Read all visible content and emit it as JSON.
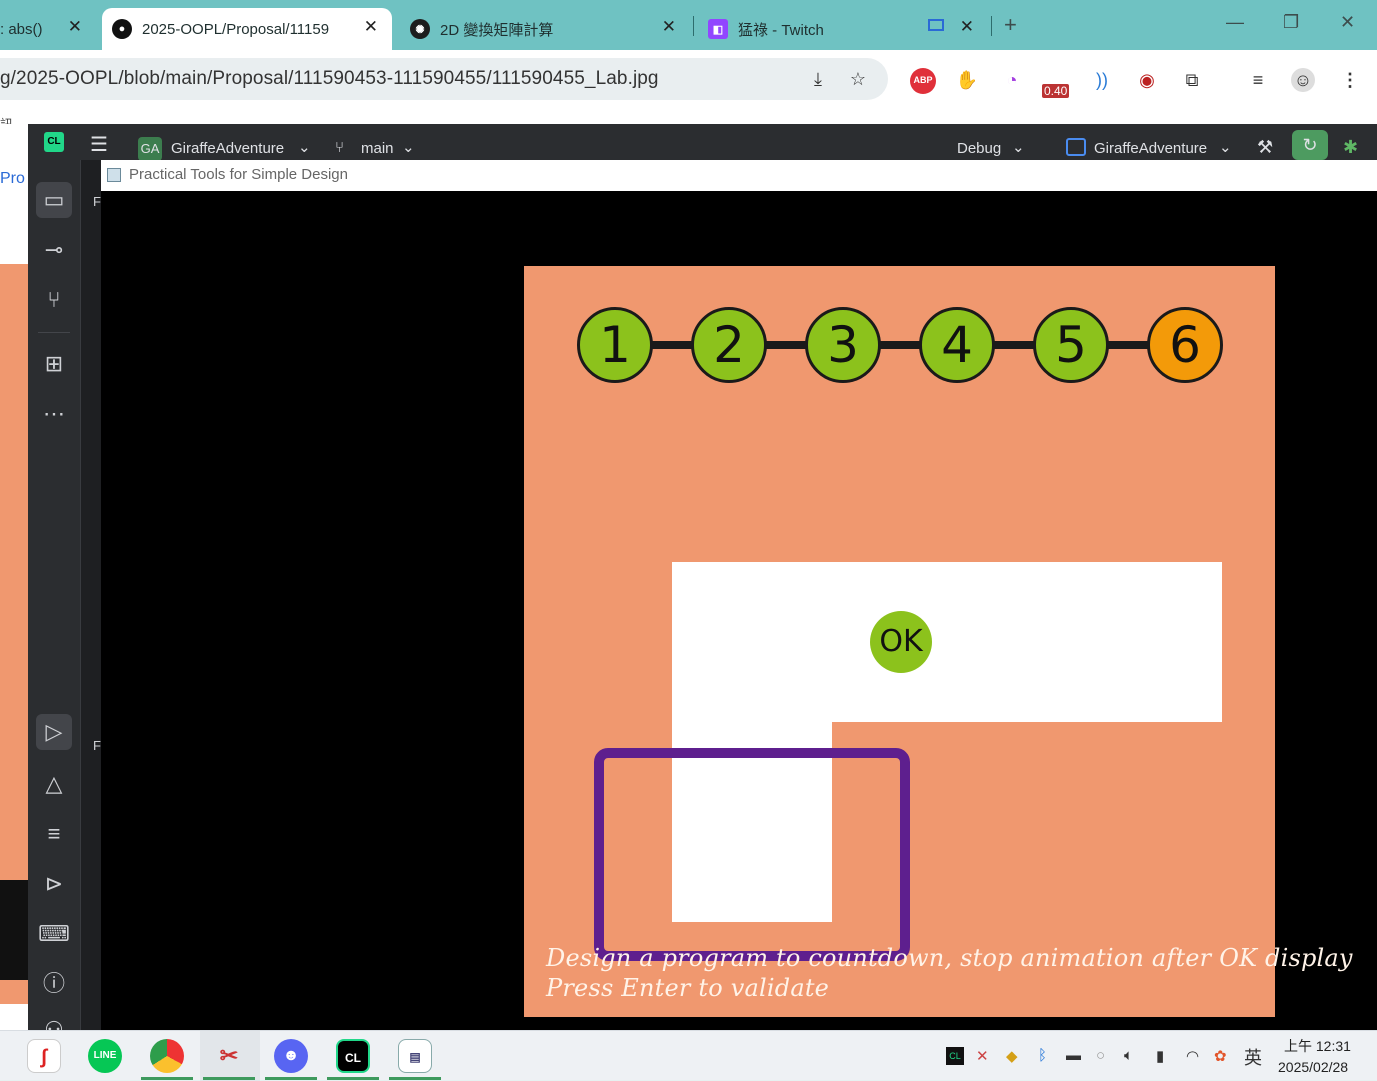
{
  "browser": {
    "tabs": [
      {
        "title": ": abs()",
        "icon": "generic-tab-icon"
      },
      {
        "title": "2025-OOPL/Proposal/11159",
        "icon": "github-icon"
      },
      {
        "title": "2D 變換矩陣計算",
        "icon": "openai-icon"
      },
      {
        "title": "猛祿 - Twitch",
        "icon": "twitch-icon"
      }
    ],
    "url": "g/2025-OOPL/blob/main/Proposal/111590453-111590455/111590455_Lab.jpg",
    "extension_badge": "0.40",
    "bookmark_edge": "訊"
  },
  "ide": {
    "project_badge": "GA",
    "project_name": "GiraffeAdventure",
    "branch": "main",
    "run_config": "Debug",
    "target": "GiraffeAdventure",
    "left_page_fragment": "Pro",
    "panel_letters": [
      "F",
      "F"
    ]
  },
  "game": {
    "window_title": "Practical Tools for Simple Design",
    "steps": [
      "1",
      "2",
      "3",
      "4",
      "5",
      "6"
    ],
    "current_step": 6,
    "ok_label": "OK",
    "instruction_lines": [
      "Design a program to countdown, stop animation after OK display",
      "Press Enter to validate"
    ],
    "colors": {
      "stage_bg": "#f0986f",
      "step_done": "#8cc21c",
      "step_current": "#f39a09",
      "frame": "#5e1f8e"
    }
  },
  "taskbar": {
    "ime": "英",
    "time": "上午 12:31",
    "date": "2025/02/28"
  }
}
